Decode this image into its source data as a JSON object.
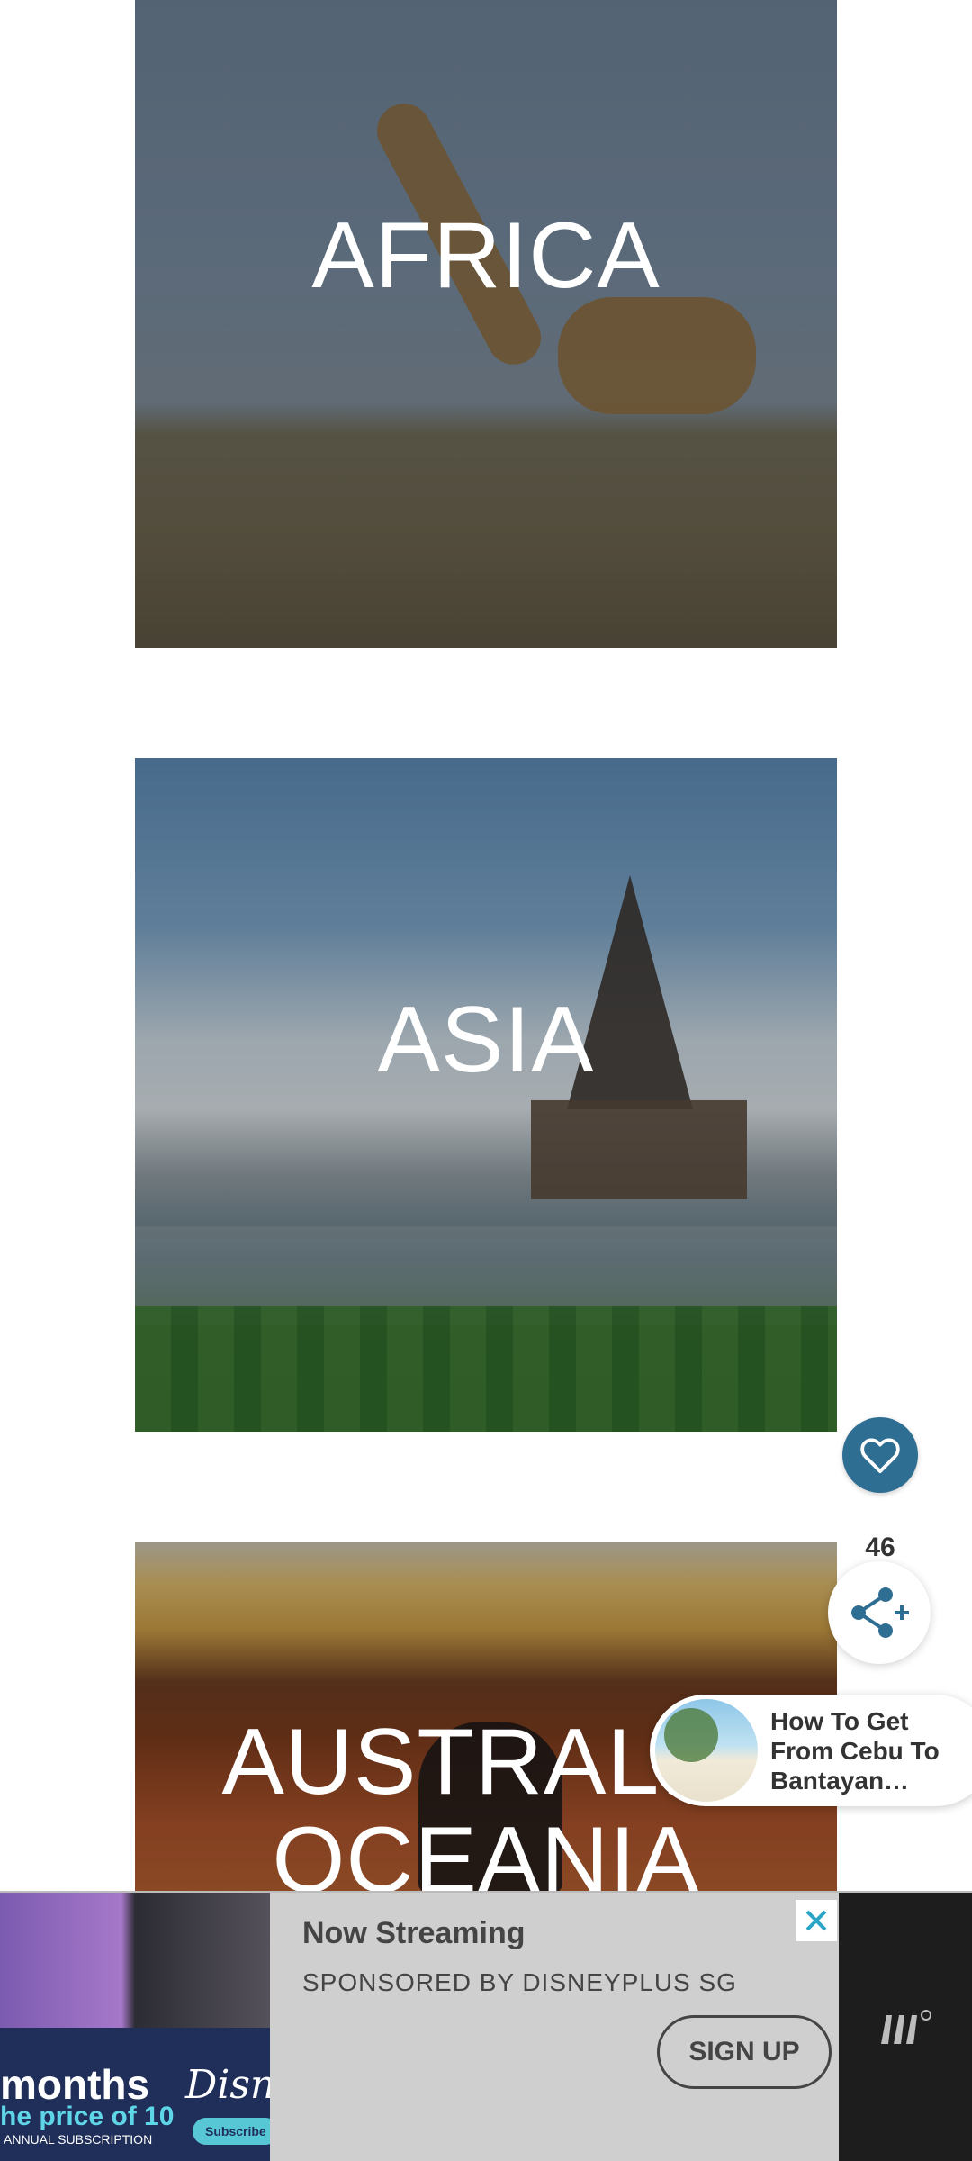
{
  "destinations": [
    {
      "title": "AFRICA"
    },
    {
      "title": "ASIA"
    },
    {
      "title": "AUSTRALIA",
      "title_line2": "OCEANIA"
    }
  ],
  "actions": {
    "like_count": "46",
    "like_icon": "heart-icon",
    "share_icon": "share-plus-icon",
    "accent_color": "#2f6e93"
  },
  "related_post": {
    "title": "How To Get From Cebu To Bantayan…"
  },
  "ad": {
    "headline": "Now Streaming",
    "sponsor": "SPONSORED BY DISNEYPLUS SG",
    "cta": "SIGN UP",
    "image": {
      "months_text": "months",
      "price_text": "he price of 10",
      "annual_text": "ANNUAL SUBSCRIPTION",
      "brand_text": "Disney",
      "subscribe_text": "Subscribe N"
    },
    "close_icon": "close-icon",
    "provider_logo": "mediavine-logo-icon"
  }
}
